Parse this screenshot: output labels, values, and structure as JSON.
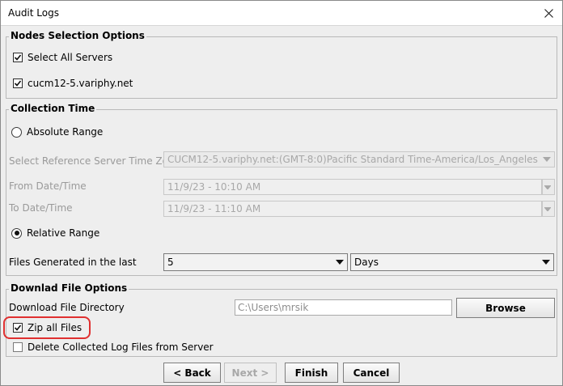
{
  "window": {
    "title": "Audit Logs"
  },
  "nodes_selection": {
    "title": "Nodes Selection Options",
    "select_all_label": "Select All Servers",
    "select_all_checked": true,
    "server_label": "cucm12-5.variphy.net",
    "server_checked": true
  },
  "collection_time": {
    "title": "Collection Time",
    "absolute_range_label": "Absolute Range",
    "absolute_selected": false,
    "ref_time_zone_label": "Select Reference Server Time Zo...",
    "ref_time_zone_value": "CUCM12-5.variphy.net:(GMT-8:0)Pacific Standard Time-America/Los_Angeles",
    "from_label": "From Date/Time",
    "from_value": "11/9/23 - 10:10 AM",
    "to_label": "To Date/Time",
    "to_value": "11/9/23 - 11:10 AM",
    "relative_range_label": "Relative Range",
    "relative_selected": true,
    "files_generated_label": "Files Generated in the last",
    "files_generated_value": "5",
    "files_generated_unit": "Days"
  },
  "download_options": {
    "title": "Downlad File Options",
    "directory_label": "Download File Directory",
    "directory_value": "C:\\Users\\mrsik",
    "browse_label": "Browse",
    "zip_label": "Zip all Files",
    "zip_checked": true,
    "delete_label": "Delete Collected Log Files from Server",
    "delete_checked": false
  },
  "footer": {
    "back_label": "< Back",
    "next_label": "Next >",
    "finish_label": "Finish",
    "cancel_label": "Cancel"
  },
  "colors": {
    "highlight": "#e03030",
    "dialog_bg": "#eeeeee"
  }
}
